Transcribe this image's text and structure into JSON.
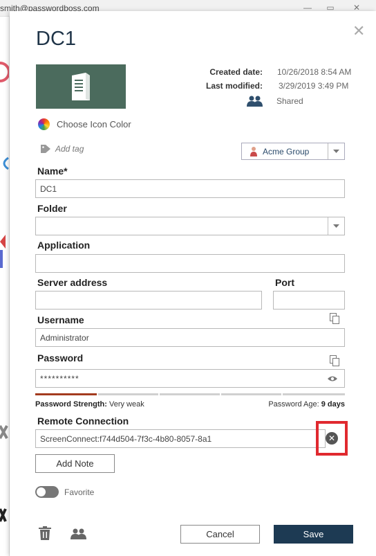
{
  "background_window": {
    "account": "smith@passwordboss.com",
    "controls": [
      "—",
      "▭",
      "✕"
    ]
  },
  "dialog": {
    "title": "DC1",
    "icon": "server-icon",
    "icon_bg_color": "#4b6b5d",
    "created_label": "Created date:",
    "created_value": "10/26/2018 8:54 AM",
    "modified_label": "Last modified:",
    "modified_value": "3/29/2019 3:49 PM",
    "shared_text": "Shared",
    "choose_icon_color": "Choose Icon Color",
    "add_tag": "Add tag",
    "group_select": "Acme Group",
    "fields": {
      "name_label": "Name*",
      "name_value": "DC1",
      "folder_label": "Folder",
      "folder_value": "",
      "application_label": "Application",
      "application_value": "",
      "server_label": "Server address",
      "server_value": "",
      "port_label": "Port",
      "port_value": "",
      "username_label": "Username",
      "username_value": "Administrator",
      "password_label": "Password",
      "password_value": "**********",
      "remote_label": "Remote Connection",
      "remote_value": "ScreenConnect:f744d504-7f3c-4b80-8057-8a1"
    },
    "strength": {
      "label": "Password Strength:",
      "value": "Very weak",
      "segments_total": 5,
      "segments_filled": 1,
      "fill_color": "#a33b1e",
      "age_label": "Password Age:",
      "age_value": "9 days"
    },
    "add_note": "Add Note",
    "favorite_label": "Favorite",
    "favorite_on": false,
    "cancel": "Cancel",
    "save": "Save",
    "accent_color": "#1d3a53",
    "highlight_color": "#e0292f"
  }
}
